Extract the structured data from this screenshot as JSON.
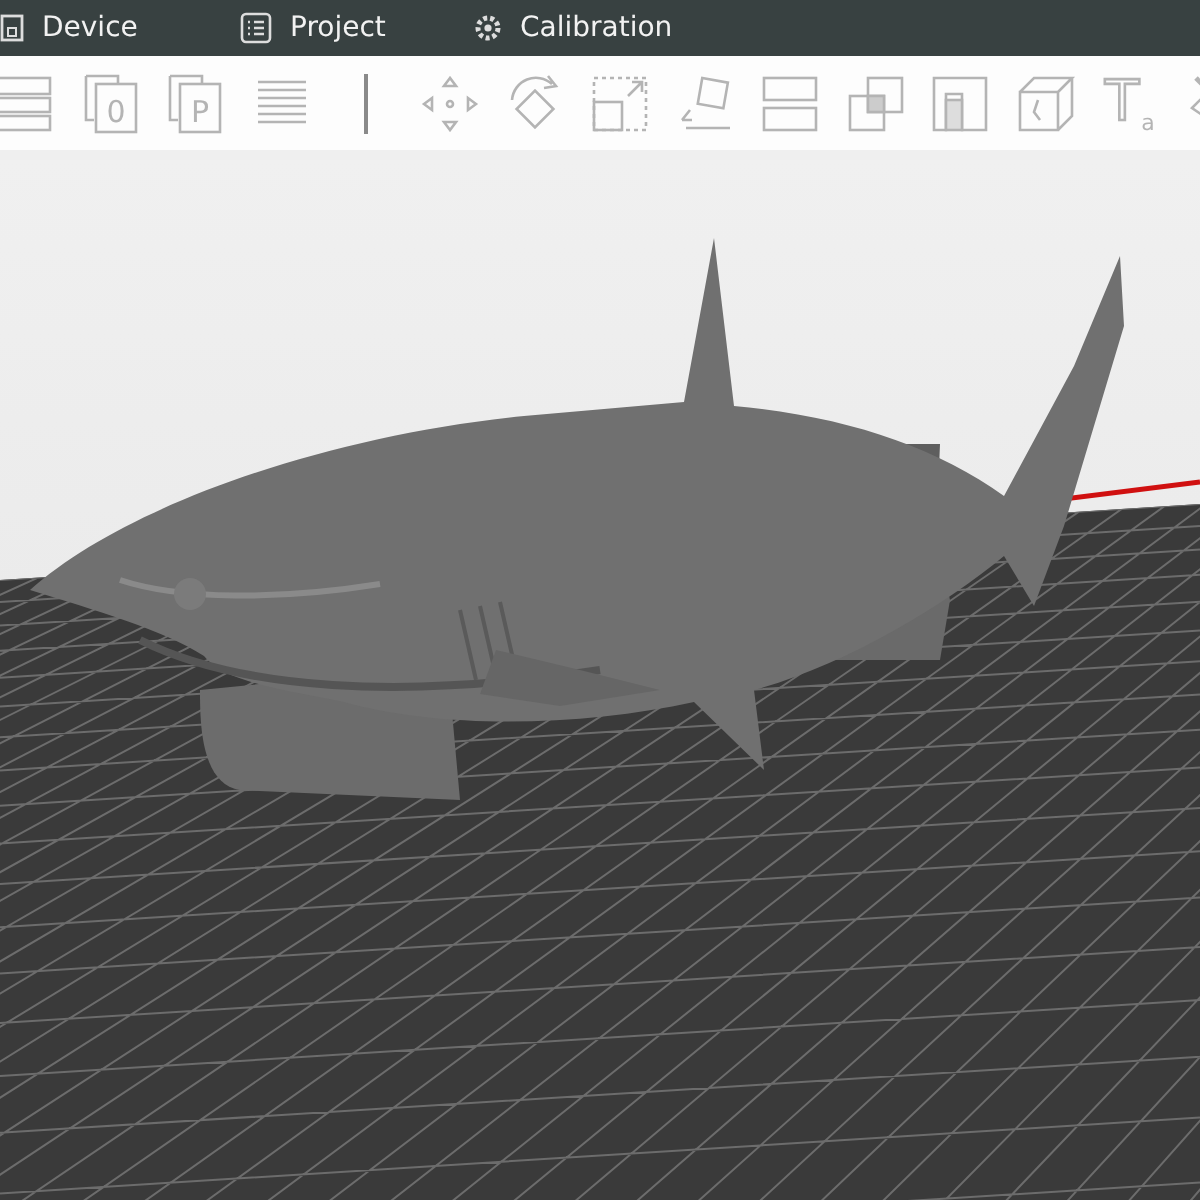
{
  "top_tabs": [
    {
      "label": "Device"
    },
    {
      "label": "Project"
    },
    {
      "label": "Calibration"
    }
  ],
  "toolbar": [
    {
      "kind": "layers"
    },
    {
      "kind": "plate_letter",
      "glyph": "0"
    },
    {
      "kind": "plate_letter",
      "glyph": "P"
    },
    {
      "kind": "arrange"
    },
    {
      "kind": "separator"
    },
    {
      "kind": "move"
    },
    {
      "kind": "rotate"
    },
    {
      "kind": "scale"
    },
    {
      "kind": "lay_flat"
    },
    {
      "kind": "cut"
    },
    {
      "kind": "boolean"
    },
    {
      "kind": "support_paint"
    },
    {
      "kind": "seam"
    },
    {
      "kind": "text",
      "glyph": "T",
      "sub": "a"
    },
    {
      "kind": "color_paint"
    }
  ]
}
